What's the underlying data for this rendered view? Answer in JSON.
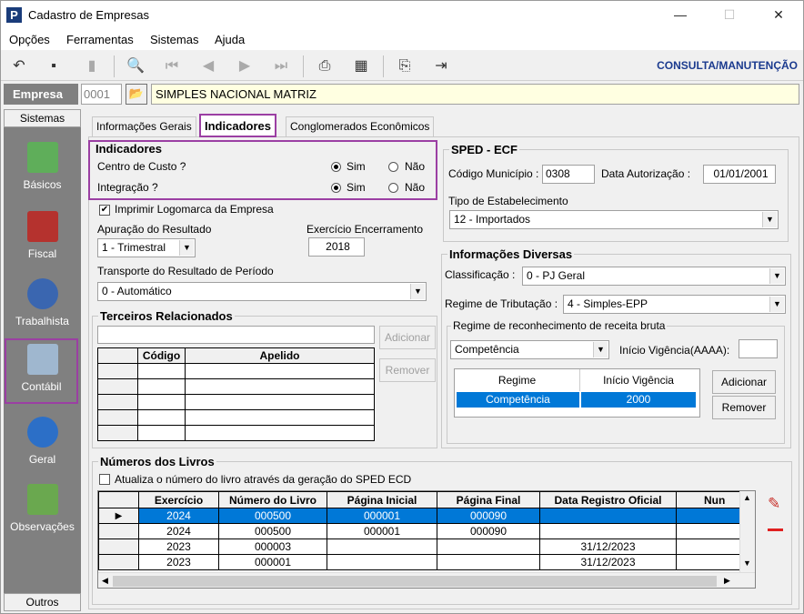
{
  "window": {
    "title": "Cadastro de Empresas",
    "minimize": "—",
    "maximize": "☐",
    "close": "✕"
  },
  "menu": [
    "Opções",
    "Ferramentas",
    "Sistemas",
    "Ajuda"
  ],
  "mode": "CONSULTA/MANUTENÇÃO",
  "empresa": {
    "label": "Empresa",
    "code": "0001",
    "name": "SIMPLES NACIONAL MATRIZ"
  },
  "sidebar": {
    "top": "Sistemas",
    "items": [
      "Básicos",
      "Fiscal",
      "Trabalhista",
      "Contábil",
      "Geral",
      "Observações"
    ],
    "bottom": "Outros"
  },
  "tabs": [
    "Informações Gerais",
    "Indicadores",
    "Conglomerados Econômicos"
  ],
  "indicadores": {
    "title": "Indicadores",
    "centro": "Centro de Custo ?",
    "integracao": "Integração ?",
    "sim": "Sim",
    "nao": "Não"
  },
  "logomarca": "Imprimir Logomarca da Empresa",
  "apuracao": {
    "label": "Apuração do Resultado",
    "value": "1 - Trimestral"
  },
  "exercicio": {
    "label": "Exercício Encerramento",
    "value": "2018"
  },
  "transporte": {
    "label": "Transporte do Resultado de Período",
    "value": "0 - Automático"
  },
  "terceiros": {
    "title": "Terceiros Relacionados",
    "col_codigo": "Código",
    "col_apelido": "Apelido",
    "add": "Adicionar",
    "remove": "Remover"
  },
  "sped": {
    "title": "SPED - ECF",
    "cod_mun_label": "Código Município :",
    "cod_mun": "0308",
    "data_aut_label": "Data Autorização :",
    "data_aut": "01/01/2001",
    "tipo_label": "Tipo de Estabelecimento",
    "tipo": "12 - Importados"
  },
  "info": {
    "title": "Informações Diversas",
    "class_label": "Classificação :",
    "class": "0 - PJ Geral",
    "regime_label": "Regime de Tributação :",
    "regime": "4 - Simples-EPP"
  },
  "receita": {
    "title": "Regime de reconhecimento de receita bruta",
    "combo": "Competência",
    "inicio_label": "Início Vigência(AAAA):",
    "col_regime": "Regime",
    "col_inicio": "Início Vigência",
    "row_regime": "Competência",
    "row_inicio": "2000",
    "add": "Adicionar",
    "remove": "Remover"
  },
  "livros": {
    "title": "Números dos Livros",
    "check": "Atualiza o número do livro através da geração do SPED ECD",
    "cols": [
      "Exercício",
      "Número do Livro",
      "Página Inicial",
      "Página Final",
      "Data Registro Oficial",
      "Nun"
    ],
    "rows": [
      [
        "2024",
        "000500",
        "000001",
        "000090",
        ""
      ],
      [
        "2024",
        "000500",
        "000001",
        "000090",
        ""
      ],
      [
        "2023",
        "000003",
        "",
        "",
        "31/12/2023"
      ],
      [
        "2023",
        "000001",
        "",
        "",
        "31/12/2023"
      ]
    ]
  }
}
